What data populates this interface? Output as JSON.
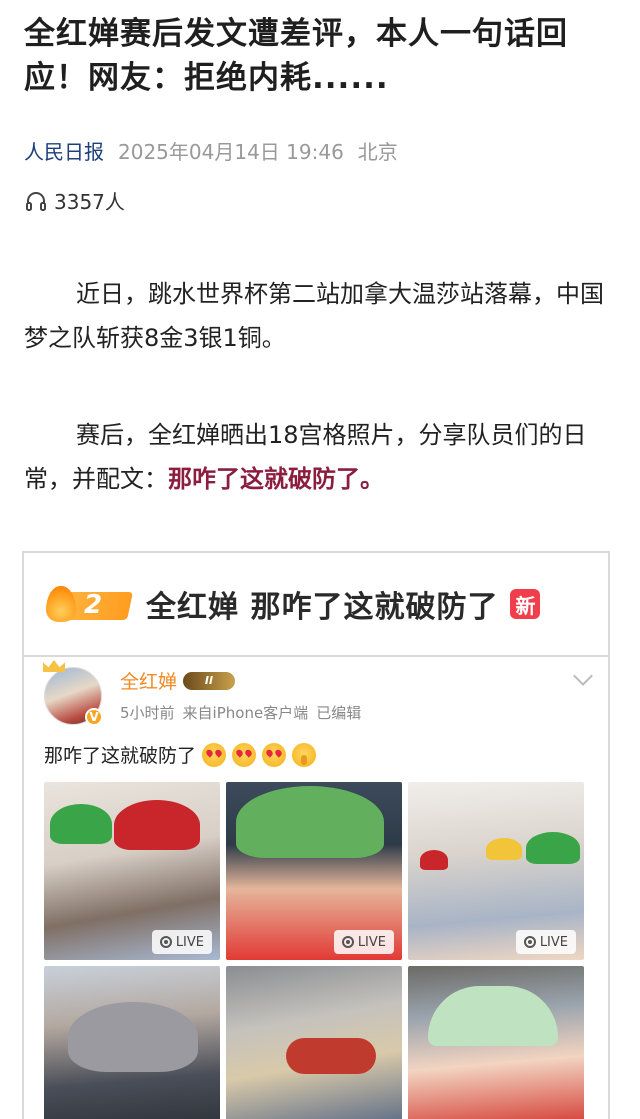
{
  "article": {
    "title": "全红婵赛后发文遭差评，本人一句话回应！网友：拒绝内耗......",
    "source": "人民日报",
    "time": "2025年04月14日 19:46",
    "location": "北京",
    "listeners": "3357人",
    "paragraph1": "近日，跳水世界杯第二站加拿大温莎站落幕，中国梦之队斩获8金3银1铜。",
    "paragraph2_prefix": "赛后，全红婵晒出18宫格照片，分享队员们的日常，并配文：",
    "paragraph2_highlight": "那咋了这就破防了。"
  },
  "hot_topic": {
    "rank": "2",
    "title": "全红婵 那咋了这就破防了",
    "badge": "新"
  },
  "weibo": {
    "username": "全红婵",
    "level": "II",
    "time_ago": "5小时前",
    "client": "来自iPhone客户端",
    "edited": "已编辑",
    "text": "那咋了这就破防了",
    "live_label": "LIVE"
  },
  "icons": {
    "listen": "headphones-icon",
    "verified": "v-badge-icon"
  },
  "colors": {
    "source": "#1d3f7a",
    "highlight": "#8b1e3f",
    "weibo_name": "#f08a24",
    "new_badge": "#f03e4c"
  }
}
